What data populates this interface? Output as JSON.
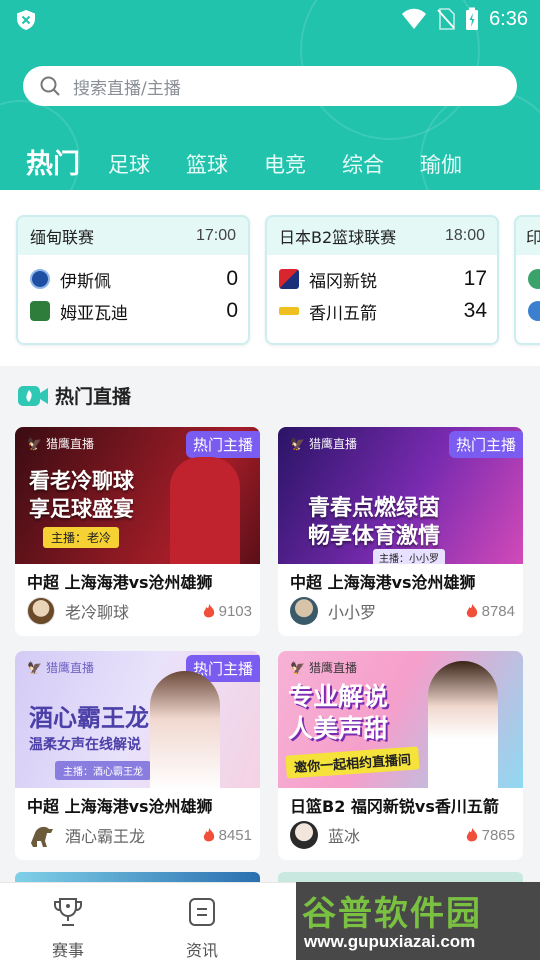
{
  "status_bar": {
    "time": "6:36"
  },
  "search": {
    "placeholder": "搜索直播/主播"
  },
  "tabs": [
    "热门",
    "足球",
    "篮球",
    "电竞",
    "综合",
    "瑜伽"
  ],
  "matches": [
    {
      "league": "缅甸联赛",
      "time": "17:00",
      "home": {
        "name": "伊斯佩",
        "score": "0",
        "color": "#1e4fa3"
      },
      "away": {
        "name": "姆亚瓦迪",
        "score": "0",
        "color": "#2f7d3a"
      }
    },
    {
      "league": "日本B2篮球联赛",
      "time": "18:00",
      "home": {
        "name": "福冈新锐",
        "score": "17",
        "color": "#d8262e"
      },
      "away": {
        "name": "香川五箭",
        "score": "34",
        "color": "#1a1a1a"
      }
    },
    {
      "league": "印"
    }
  ],
  "section": {
    "title": "热门直播"
  },
  "lives": [
    {
      "tag": "热门主播",
      "brand": "猎鹰直播",
      "promo_line1": "看老冷聊球",
      "promo_line2": "享足球盛宴",
      "promo_anchor": "主播：老冷",
      "title": "中超 上海海港vs沧州雄狮",
      "anchor": "老冷聊球",
      "heat": "9103",
      "bg": "#4a1018",
      "bg2": "#b81f2b"
    },
    {
      "tag": "热门主播",
      "brand": "猎鹰直播",
      "promo_line1": "青春点燃绿茵",
      "promo_line2": "畅享体育激情",
      "promo_anchor": "主播：小小罗",
      "title": "中超 上海海港vs沧州雄狮",
      "anchor": "小小罗",
      "heat": "8784",
      "bg": "#3a1f7a",
      "bg2": "#c43ac2"
    },
    {
      "tag": "热门主播",
      "brand": "猎鹰直播",
      "promo_line1": "酒心霸王龙",
      "promo_line2": "温柔女声在线解说",
      "promo_anchor": "主播：酒心霸王龙",
      "title": "中超 上海海港vs沧州雄狮",
      "anchor": "酒心霸王龙",
      "heat": "8451",
      "bg": "#c9bff2",
      "bg2": "#f3c9df"
    },
    {
      "brand": "猎鹰直播",
      "promo_line1": "专业解说",
      "promo_line2": "人美声甜",
      "promo_anchor": "邀你一起相约直播间",
      "title": "日篮B2 福冈新锐vs香川五箭",
      "anchor": "蓝冰",
      "heat": "7865",
      "bg": "#f6a7cf",
      "bg2": "#7fd6f0"
    }
  ],
  "bottom_nav": [
    {
      "label": "赛事",
      "icon": "trophy-icon"
    },
    {
      "label": "资讯",
      "icon": "news-icon"
    }
  ],
  "watermark": {
    "brand": "谷普软件园",
    "url": "www.gupuxiazai.com"
  },
  "colors": {
    "primary": "#21c3ad",
    "tag": "#7b5cf0",
    "fire": "#f0503a"
  }
}
